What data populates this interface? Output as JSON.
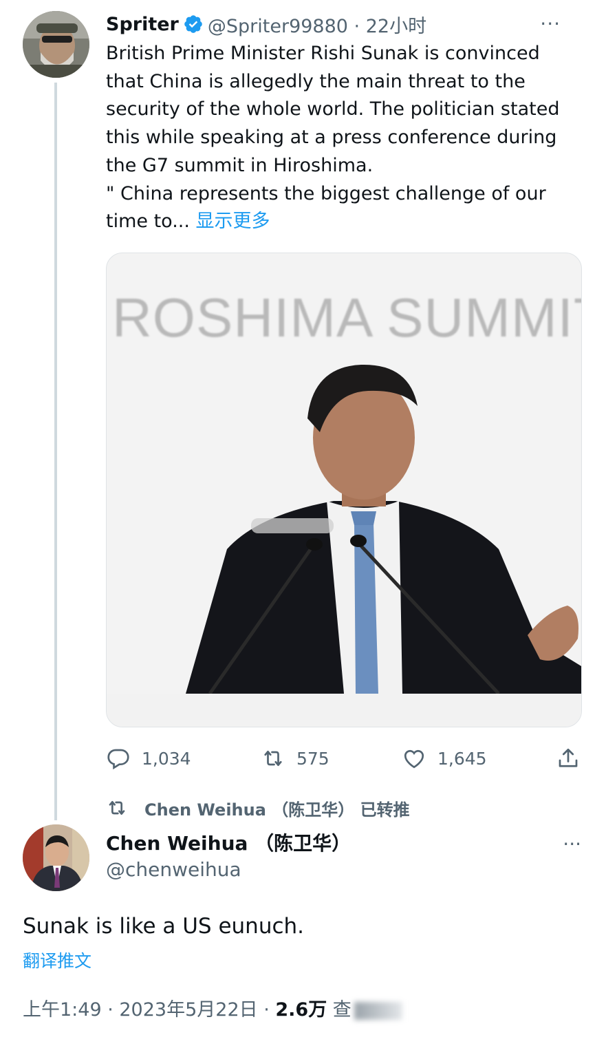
{
  "parent_tweet": {
    "author_name": "Spriter",
    "handle_and_time": "@Spriter99880 · 22小时",
    "more_icon": "···",
    "text_lines": [
      "British Prime Minister Rishi Sunak is convinced",
      "that China is allegedly the main threat to the",
      "security of the whole world. The politician stated",
      "this while speaking at a press conference during",
      "the G7 summit in Hiroshima.",
      " \" China represents the biggest challenge of our"
    ],
    "last_line_prefix": "time to... ",
    "show_more": "显示更多",
    "media_banner_text": "ROSHIMA SUMMIT",
    "actions": {
      "reply_count": "1,034",
      "retweet_count": "575",
      "like_count": "1,645"
    },
    "icons": {
      "verified": "verified-badge-icon",
      "reply": "reply-bubble-icon",
      "retweet": "retweet-icon",
      "like": "heart-icon",
      "share": "share-icon"
    },
    "colors": {
      "accent": "#1d9bf0",
      "secondary_text": "#536471"
    }
  },
  "retweet_banner": {
    "text": "Chen Weihua （陈卫华） 已转推"
  },
  "main_tweet": {
    "author_name": "Chen Weihua （陈卫华）",
    "handle": "@chenweihua",
    "more_icon": "···",
    "text": "Sunak is like a US eunuch.",
    "translate_label": "翻译推文",
    "meta_time": "上午1:49 · 2023年5月22日 · ",
    "meta_views": "2.6万",
    "meta_views_suffix": " 查"
  }
}
